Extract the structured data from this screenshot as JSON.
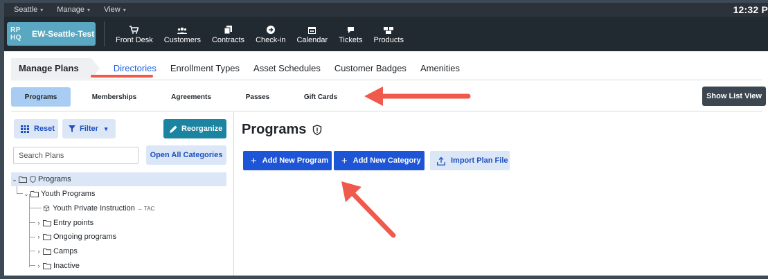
{
  "menubar": {
    "items": [
      {
        "label": "Seattle"
      },
      {
        "label": "Manage"
      },
      {
        "label": "View"
      }
    ],
    "clock": "12:32 P"
  },
  "appbar": {
    "brand_logo": "RP HQ",
    "brand_name": "EW-Seattle-Test",
    "nav": [
      {
        "label": "Front Desk",
        "icon": "cart-icon"
      },
      {
        "label": "Customers",
        "icon": "users-icon"
      },
      {
        "label": "Contracts",
        "icon": "documents-icon"
      },
      {
        "label": "Check-in",
        "icon": "arrow-circle-icon"
      },
      {
        "label": "Calendar",
        "icon": "calendar-icon"
      },
      {
        "label": "Tickets",
        "icon": "chat-bubble-icon"
      },
      {
        "label": "Products",
        "icon": "boxes-icon"
      }
    ]
  },
  "tabs": {
    "manage_label": "Manage Plans",
    "items": [
      {
        "label": "Directories",
        "active": true
      },
      {
        "label": "Enrollment Types"
      },
      {
        "label": "Asset Schedules"
      },
      {
        "label": "Customer Badges"
      },
      {
        "label": "Amenities"
      }
    ]
  },
  "subtabs": {
    "items": [
      {
        "label": "Programs",
        "active": true
      },
      {
        "label": "Memberships"
      },
      {
        "label": "Agreements"
      },
      {
        "label": "Passes"
      },
      {
        "label": "Gift Cards"
      }
    ],
    "show_list_view": "Show List View"
  },
  "left": {
    "reset_label": "Reset",
    "filter_label": "Filter",
    "reorganize_label": "Reorganize",
    "search_placeholder": "Search Plans",
    "open_all_label": "Open All Categories",
    "tree": [
      {
        "label": "Programs",
        "selected": true
      },
      {
        "label": "Youth Programs"
      },
      {
        "label": "Youth Private Instruction",
        "suffix": "→ TAC"
      },
      {
        "label": "Entry points"
      },
      {
        "label": "Ongoing programs"
      },
      {
        "label": "Camps"
      },
      {
        "label": "Inactive"
      }
    ]
  },
  "main": {
    "title": "Programs",
    "add_program_label": "Add New Program",
    "add_category_label": "Add New Category",
    "import_label": "Import Plan File"
  },
  "colors": {
    "accent_blue": "#1e55d6",
    "annotation_red": "#ef5a4c",
    "brand_teal": "#5aa7c2"
  }
}
